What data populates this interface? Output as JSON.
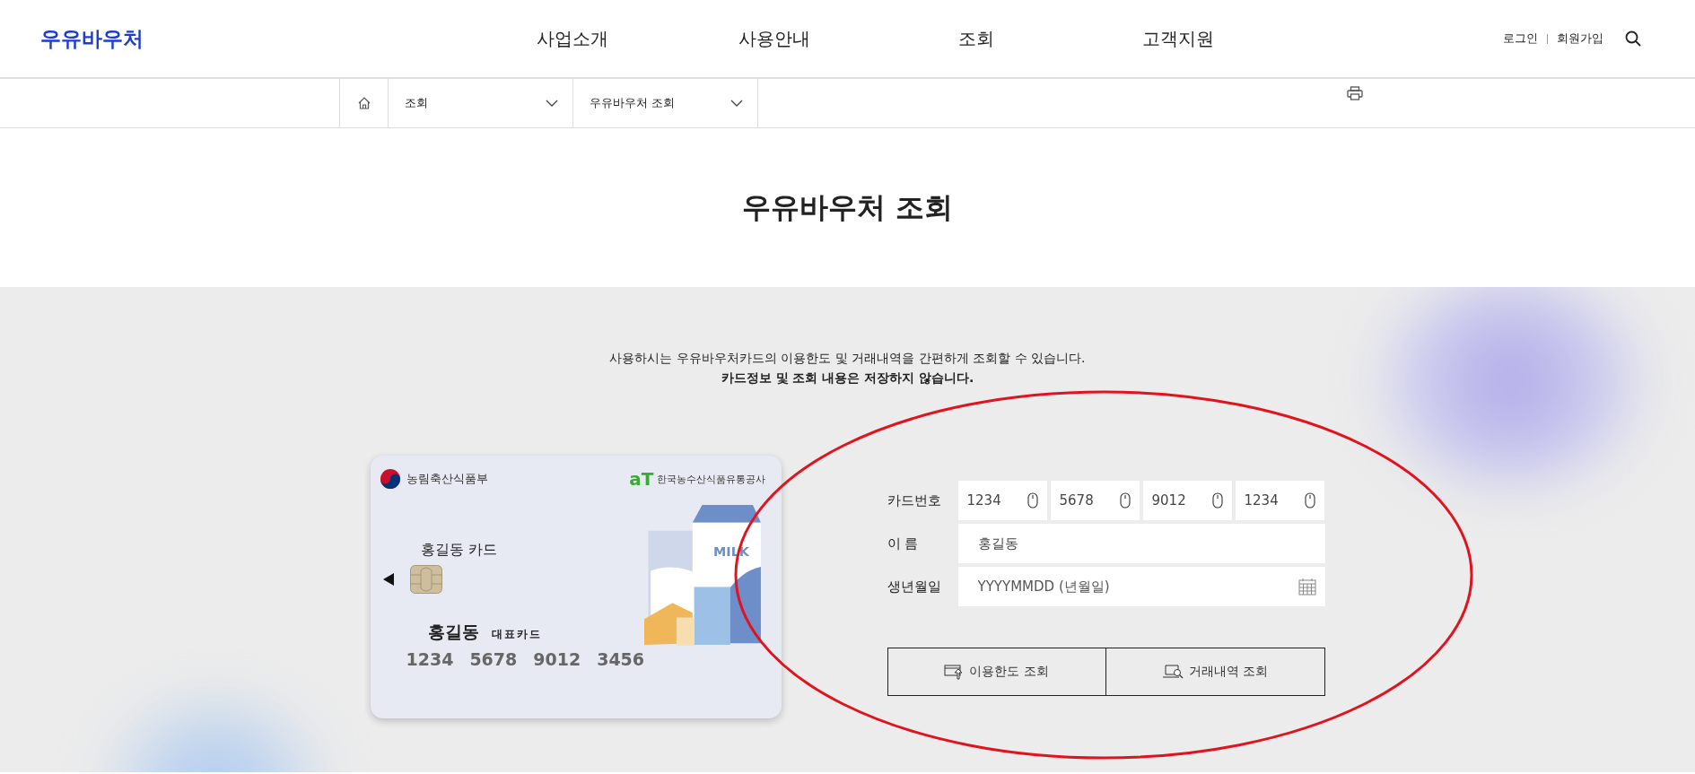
{
  "header": {
    "logo": "우유바우처",
    "nav": [
      {
        "label": "사업소개"
      },
      {
        "label": "사용안내"
      },
      {
        "label": "조회"
      },
      {
        "label": "고객지원"
      }
    ],
    "utility_links": [
      "로그인",
      "회원가입"
    ]
  },
  "breadcrumb": {
    "items": [
      "조회",
      "우유바우처 조회"
    ]
  },
  "page_title": "우유바우처 조회",
  "intro": {
    "text": "사용하시는 우유바우처카드의 이용한도 및 거래내역을 간편하게 조회할 수 있습니다.",
    "notice": "카드정보 및 조회 내용은 저장하지 않습니다."
  },
  "card": {
    "ministry": "농림축산식품부",
    "agency_mark": "aT",
    "agency": "한국농수산식품유통공사",
    "card_name": "홍길동 카드",
    "holder": "홍길동",
    "badge": "대표카드",
    "number": [
      "1234",
      "5678",
      "9012",
      "3456"
    ],
    "milk_label": "MILK"
  },
  "form": {
    "fields": [
      {
        "kind": "card",
        "label": "카드번호",
        "parts": [
          "1234",
          "5678",
          "9012",
          "1234"
        ]
      },
      {
        "kind": "text",
        "label": "이 름",
        "value": "홍길동"
      },
      {
        "kind": "date",
        "label": "생년월일",
        "placeholder": "YYYYMMDD (년월일)"
      }
    ],
    "buttons": [
      {
        "kind": "limit",
        "label": "이용한도 조회"
      },
      {
        "kind": "history",
        "label": "거래내역 조회"
      }
    ]
  }
}
